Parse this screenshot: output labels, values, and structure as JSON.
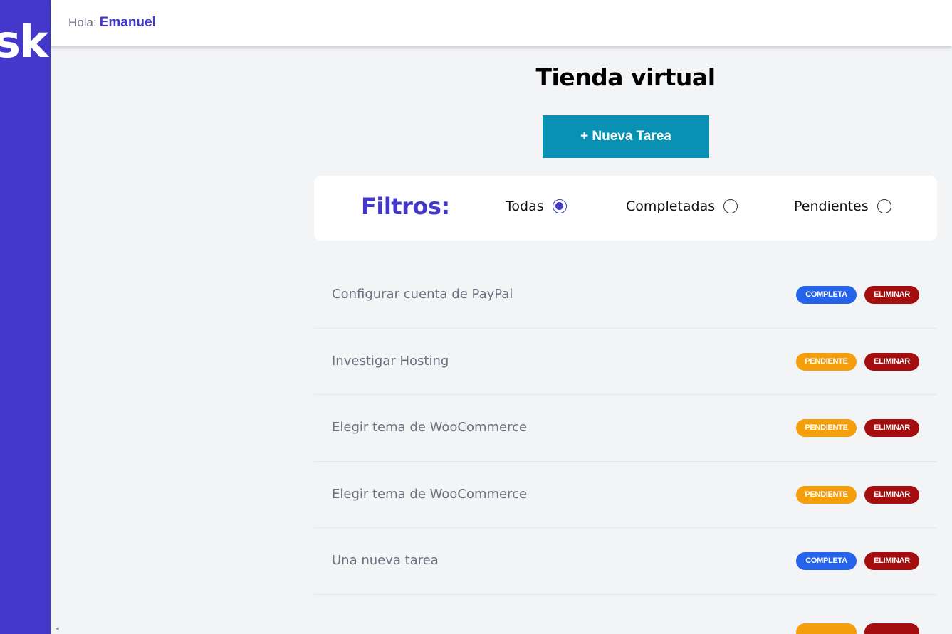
{
  "sidebar": {
    "logo_text": "sk"
  },
  "header": {
    "greeting": "Hola:",
    "username": "Emanuel"
  },
  "main": {
    "title": "Tienda virtual",
    "new_task_label": "+ Nueva Tarea",
    "filters": {
      "title": "Filtros:",
      "options": [
        {
          "label": "Todas",
          "checked": true
        },
        {
          "label": "Completadas",
          "checked": false
        },
        {
          "label": "Pendientes",
          "checked": false
        }
      ]
    },
    "tasks": [
      {
        "name": "Configurar cuenta de PayPal",
        "state": "COMPLETA",
        "delete_label": "ELIMINAR"
      },
      {
        "name": "Investigar Hosting",
        "state": "PENDIENTE",
        "delete_label": "ELIMINAR"
      },
      {
        "name": "Elegir tema de WooCommerce",
        "state": "PENDIENTE",
        "delete_label": "ELIMINAR"
      },
      {
        "name": "Elegir tema de WooCommerce",
        "state": "PENDIENTE",
        "delete_label": "ELIMINAR"
      },
      {
        "name": "Una nueva tarea",
        "state": "COMPLETA",
        "delete_label": "ELIMINAR"
      }
    ]
  },
  "colors": {
    "sidebar": "#4338ca",
    "accent": "#4338ca",
    "button": "#0891b2",
    "completa": "#2563eb",
    "pendiente": "#f59e0b",
    "eliminar": "#a50e0e"
  }
}
